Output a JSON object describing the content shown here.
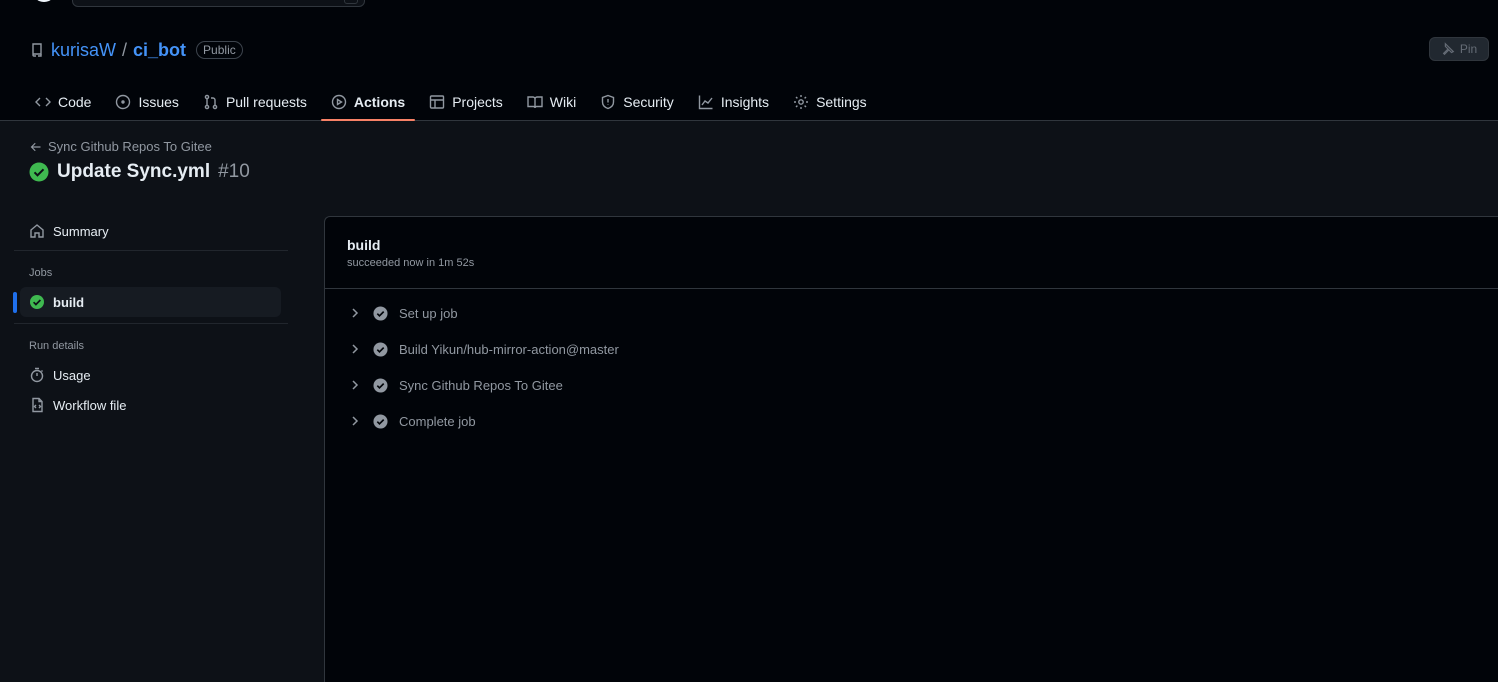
{
  "repo": {
    "owner": "kurisaW",
    "separator": "/",
    "name": "ci_bot",
    "visibility": "Public",
    "pin_label": "Pin"
  },
  "tabs": [
    {
      "label": "Code",
      "icon": "code-icon"
    },
    {
      "label": "Issues",
      "icon": "issue-icon"
    },
    {
      "label": "Pull requests",
      "icon": "pull-request-icon"
    },
    {
      "label": "Actions",
      "icon": "play-icon",
      "active": true
    },
    {
      "label": "Projects",
      "icon": "table-icon"
    },
    {
      "label": "Wiki",
      "icon": "book-icon"
    },
    {
      "label": "Security",
      "icon": "shield-icon"
    },
    {
      "label": "Insights",
      "icon": "graph-icon"
    },
    {
      "label": "Settings",
      "icon": "gear-icon"
    }
  ],
  "run": {
    "back_label": "Sync Github Repos To Gitee",
    "title": "Update Sync.yml",
    "number": "#10",
    "status": "success"
  },
  "sidebar": {
    "summary_label": "Summary",
    "jobs_heading": "Jobs",
    "jobs": [
      {
        "label": "build",
        "selected": true
      }
    ],
    "run_details_heading": "Run details",
    "usage_label": "Usage",
    "workflow_file_label": "Workflow file"
  },
  "job": {
    "name": "build",
    "status_text": "succeeded now in 1m 52s",
    "steps": [
      {
        "label": "Set up job"
      },
      {
        "label": "Build Yikun/hub-mirror-action@master"
      },
      {
        "label": "Sync Github Repos To Gitee"
      },
      {
        "label": "Complete job"
      }
    ]
  },
  "colors": {
    "accent": "#4493f8",
    "success": "#3fb950",
    "active_tab_underline": "#f78166",
    "selected_indicator": "#1f6feb"
  }
}
